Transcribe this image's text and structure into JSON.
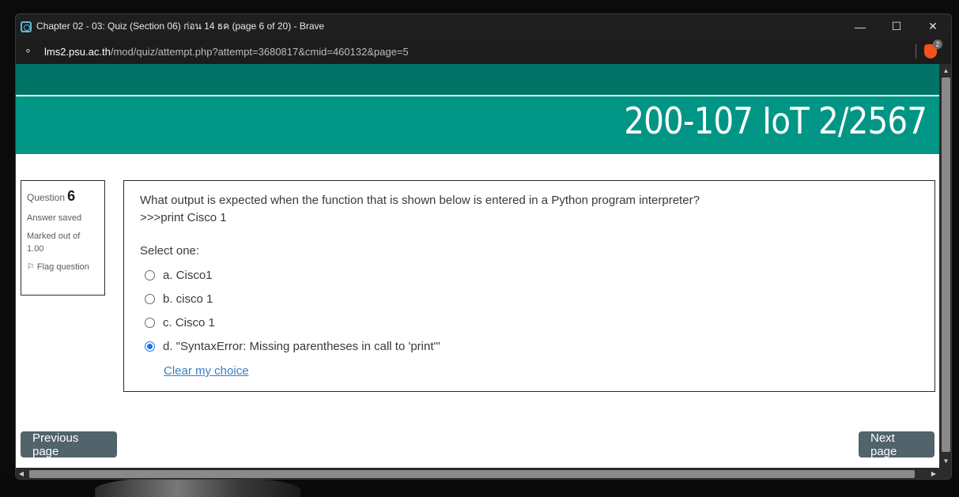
{
  "window": {
    "title": "Chapter 02 - 03: Quiz (Section 06) ก่อน 14 ธค (page 6 of 20) - Brave",
    "controls": {
      "minimize": "—",
      "maximize": "☐",
      "close": "✕"
    }
  },
  "address_bar": {
    "host": "lms2.psu.ac.th",
    "path": "/mod/quiz/attempt.php?attempt=3680817&cmid=460132&page=5",
    "brave_badge": "2"
  },
  "course": {
    "title": "200-107 IoT 2/2567"
  },
  "question_info": {
    "label": "Question",
    "number": "6",
    "state": "Answer saved",
    "marked_out_of": "Marked out of 1.00",
    "flag_label": "Flag question"
  },
  "question": {
    "text_line1": "What output is expected when the function that is shown below is entered in a Python program interpreter?",
    "text_line2": ">>>print Cisco 1",
    "prompt": "Select one:",
    "options": [
      {
        "label": "a. Cisco1",
        "checked": false
      },
      {
        "label": "b. cisco 1",
        "checked": false
      },
      {
        "label": "c. Cisco 1",
        "checked": false
      },
      {
        "label": "d. \"SyntaxError: Missing parentheses in call to 'print'\"",
        "checked": true
      }
    ],
    "clear_label": "Clear my choice"
  },
  "navigation": {
    "previous_label": "Previous page",
    "next_label": "Next page"
  },
  "colors": {
    "header_dark": "#017467",
    "header_teal": "#009585",
    "button": "#51636b",
    "link": "#3a7fc1",
    "radio_checked": "#1a73e8"
  }
}
